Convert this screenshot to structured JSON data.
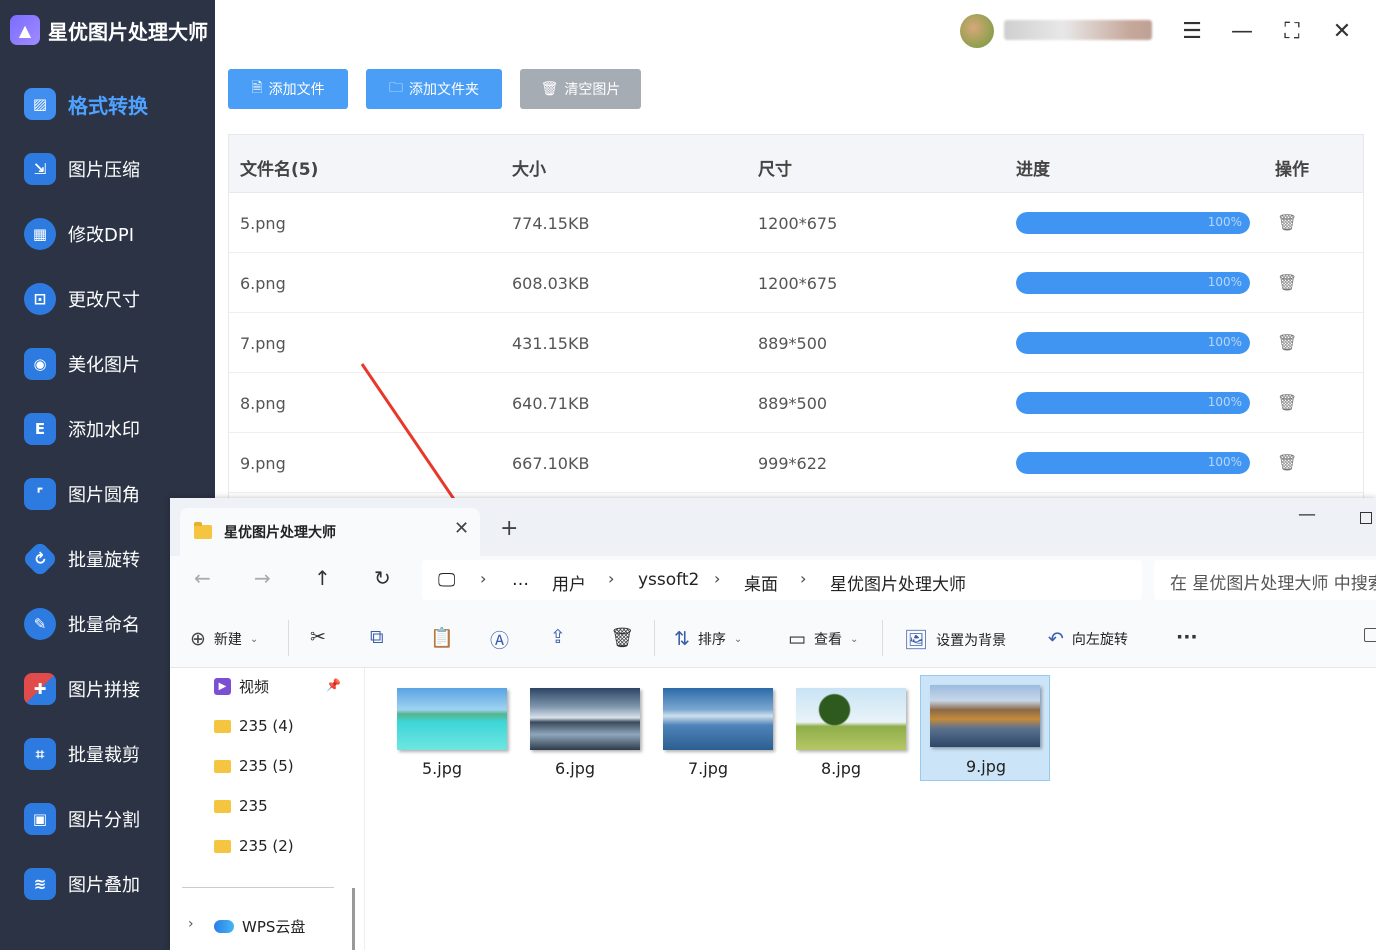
{
  "app": {
    "title": "星优图片处理大师",
    "logo_icon": "image-icon"
  },
  "sidebar": {
    "items": [
      {
        "label": "格式转换",
        "icon": "format-convert-icon",
        "color": "#3f8ef0",
        "active": true
      },
      {
        "label": "图片压缩",
        "icon": "compress-icon",
        "color": "#2d7be0"
      },
      {
        "label": "修改DPI",
        "icon": "dpi-icon",
        "color": "#2d7be0"
      },
      {
        "label": "更改尺寸",
        "icon": "resize-icon",
        "color": "#2d7be0"
      },
      {
        "label": "美化图片",
        "icon": "beautify-icon",
        "color": "#2d7be0"
      },
      {
        "label": "添加水印",
        "icon": "watermark-icon",
        "color": "#2d7be0"
      },
      {
        "label": "图片圆角",
        "icon": "round-corner-icon",
        "color": "#2d7be0"
      },
      {
        "label": "批量旋转",
        "icon": "rotate-icon",
        "color": "#2d7be0"
      },
      {
        "label": "批量命名",
        "icon": "rename-icon",
        "color": "#2d7be0"
      },
      {
        "label": "图片拼接",
        "icon": "puzzle-icon",
        "color": "#e04b4b"
      },
      {
        "label": "批量裁剪",
        "icon": "crop-icon",
        "color": "#2d7be0"
      },
      {
        "label": "图片分割",
        "icon": "split-icon",
        "color": "#2d7be0"
      },
      {
        "label": "图片叠加",
        "icon": "layers-icon",
        "color": "#2d7be0"
      }
    ]
  },
  "toolbar": {
    "add_file": "添加文件",
    "add_folder": "添加文件夹",
    "clear_images": "清空图片"
  },
  "table": {
    "headers": {
      "name": "文件名(5)",
      "size": "大小",
      "dims": "尺寸",
      "progress": "进度",
      "actions": "操作"
    },
    "rows": [
      {
        "name": "5.png",
        "size": "774.15KB",
        "dims": "1200*675",
        "progress": 100,
        "progress_text": "100%"
      },
      {
        "name": "6.png",
        "size": "608.03KB",
        "dims": "1200*675",
        "progress": 100,
        "progress_text": "100%"
      },
      {
        "name": "7.png",
        "size": "431.15KB",
        "dims": "889*500",
        "progress": 100,
        "progress_text": "100%"
      },
      {
        "name": "8.png",
        "size": "640.71KB",
        "dims": "889*500",
        "progress": 100,
        "progress_text": "100%"
      },
      {
        "name": "9.png",
        "size": "667.10KB",
        "dims": "999*622",
        "progress": 100,
        "progress_text": "100%"
      }
    ]
  },
  "explorer": {
    "tab_title": "星优图片处理大师",
    "breadcrumb": [
      "用户",
      "yssoft2",
      "桌面",
      "星优图片处理大师"
    ],
    "more_crumbs": "…",
    "search_placeholder": "在 星优图片处理大师 中搜索",
    "commands": {
      "new": "新建",
      "sort": "排序",
      "view": "查看",
      "set_background": "设置为背景",
      "rotate_left": "向左旋转",
      "more": "···"
    },
    "nav_items": [
      {
        "label": "视频",
        "type": "video"
      },
      {
        "label": "235 (4)",
        "type": "folder"
      },
      {
        "label": "235 (5)",
        "type": "folder"
      },
      {
        "label": "235",
        "type": "folder"
      },
      {
        "label": "235 (2)",
        "type": "folder"
      }
    ],
    "cloud_item": "WPS云盘",
    "files": [
      {
        "name": "5.jpg",
        "selected": false
      },
      {
        "name": "6.jpg",
        "selected": false
      },
      {
        "name": "7.jpg",
        "selected": false
      },
      {
        "name": "8.jpg",
        "selected": false
      },
      {
        "name": "9.jpg",
        "selected": true
      }
    ]
  },
  "colors": {
    "accent": "#4a9ef5",
    "sidebar_bg": "#2b3344",
    "active_nav": "#4ea1ff",
    "progress": "#3f95f1",
    "annotation_arrow": "#e8382a"
  }
}
